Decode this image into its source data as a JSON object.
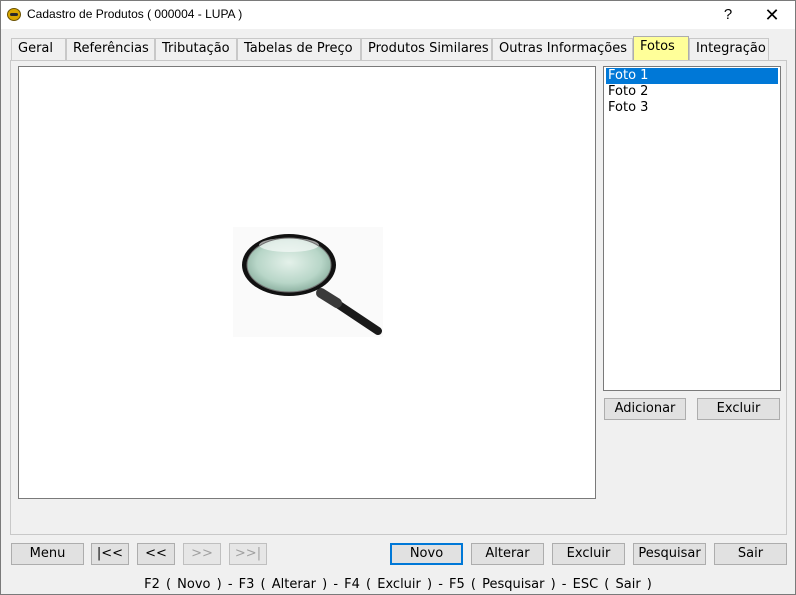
{
  "window": {
    "title": "Cadastro de Produtos ( 000004 - LUPA )",
    "help_label": "?",
    "close_label": "✕"
  },
  "tabs": [
    {
      "label": "Geral"
    },
    {
      "label": "Referências"
    },
    {
      "label": "Tributação"
    },
    {
      "label": "Tabelas de Preço"
    },
    {
      "label": "Produtos Similares"
    },
    {
      "label": "Outras Informações"
    },
    {
      "label": "Fotos",
      "active": true
    },
    {
      "label": "Integração"
    }
  ],
  "photos": {
    "items": [
      "Foto 1",
      "Foto 2",
      "Foto 3"
    ],
    "selected_index": 0,
    "image_icon": "magnifying-glass",
    "add_label": "Adicionar",
    "delete_label": "Excluir"
  },
  "nav": {
    "menu_label": "Menu",
    "first_label": "|<<",
    "prev_label": "<<",
    "next_label": ">>",
    "last_label": ">>|"
  },
  "actions": {
    "new_label": "Novo",
    "edit_label": "Alterar",
    "delete_label": "Excluir",
    "search_label": "Pesquisar",
    "exit_label": "Sair"
  },
  "status": {
    "shortcuts": "F2 ( Novo )  -  F3 ( Alterar )  -  F4 ( Excluir )  -  F5 ( Pesquisar )  -  ESC ( Sair )"
  },
  "colors": {
    "active_tab": "#ffff99",
    "selection": "#0078d7"
  }
}
